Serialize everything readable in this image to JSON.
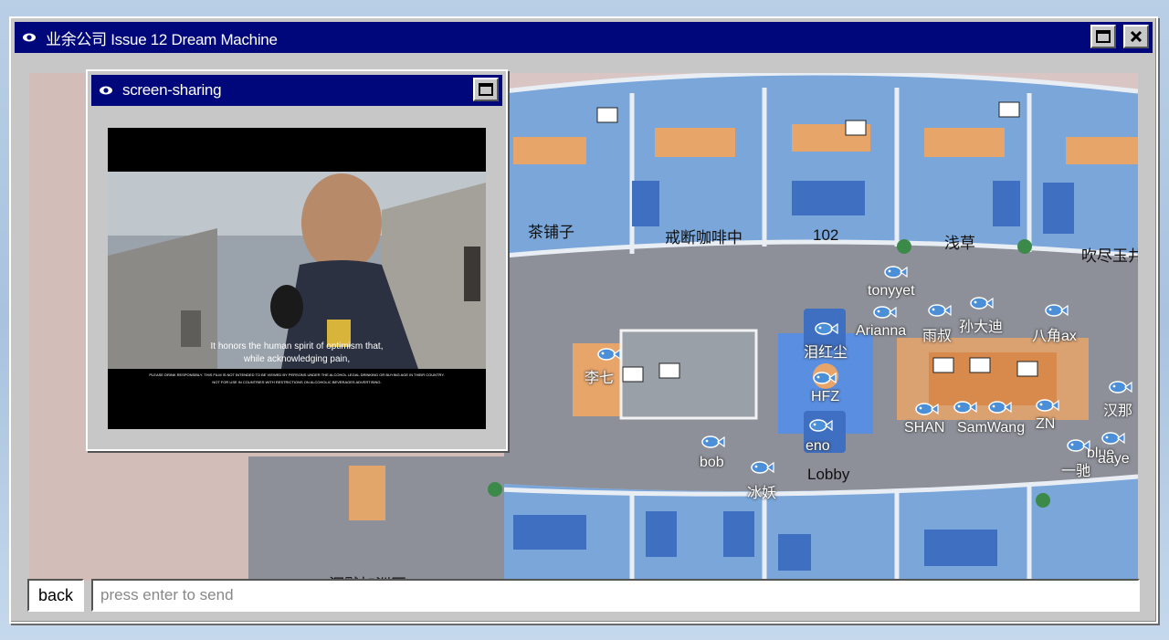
{
  "window": {
    "title": "业余公司 Issue 12 Dream Machine"
  },
  "sub_window": {
    "title": "screen-sharing"
  },
  "video": {
    "subtitle_1": "It honors the human spirit of optimism that,",
    "subtitle_2": "while acknowledging pain,",
    "disclaimer_1": "PLEASE DRINK RESPONSIBLY. THIS FILM IS NOT INTENDED TO BE VIEWED BY PERSONS UNDER THE ALCOHOL LEGAL DRINKING OR BUYING AGE IN THEIR COUNTRY.",
    "disclaimer_2": "NOT FOR USE IN COUNTRIES WITH RESTRICTIONS ON ALCOHOLIC BEVERAGES ADVERTISING."
  },
  "rooms": [
    "茶铺子",
    "戒断咖啡中",
    "102",
    "浅草",
    "吹尽玉井",
    "沉默加洲区",
    "Lobby"
  ],
  "users": [
    "tonyyet",
    "Arianna",
    "雨叔",
    "孙大迪",
    "八角ax",
    "泪红尘",
    "李七",
    "HFZ",
    "SHAN",
    "SamWang",
    "ZN",
    "汉那",
    "eno",
    "bob",
    "冰妖",
    "一驰",
    "blue",
    "aaye"
  ],
  "bottom": {
    "back_label": "back",
    "input_placeholder": "press enter to send"
  },
  "colors": {
    "titlebar": "#00077a",
    "window": "#c7c7c7",
    "room_floor": "#7aa6d9",
    "corridor": "#8d9099"
  }
}
